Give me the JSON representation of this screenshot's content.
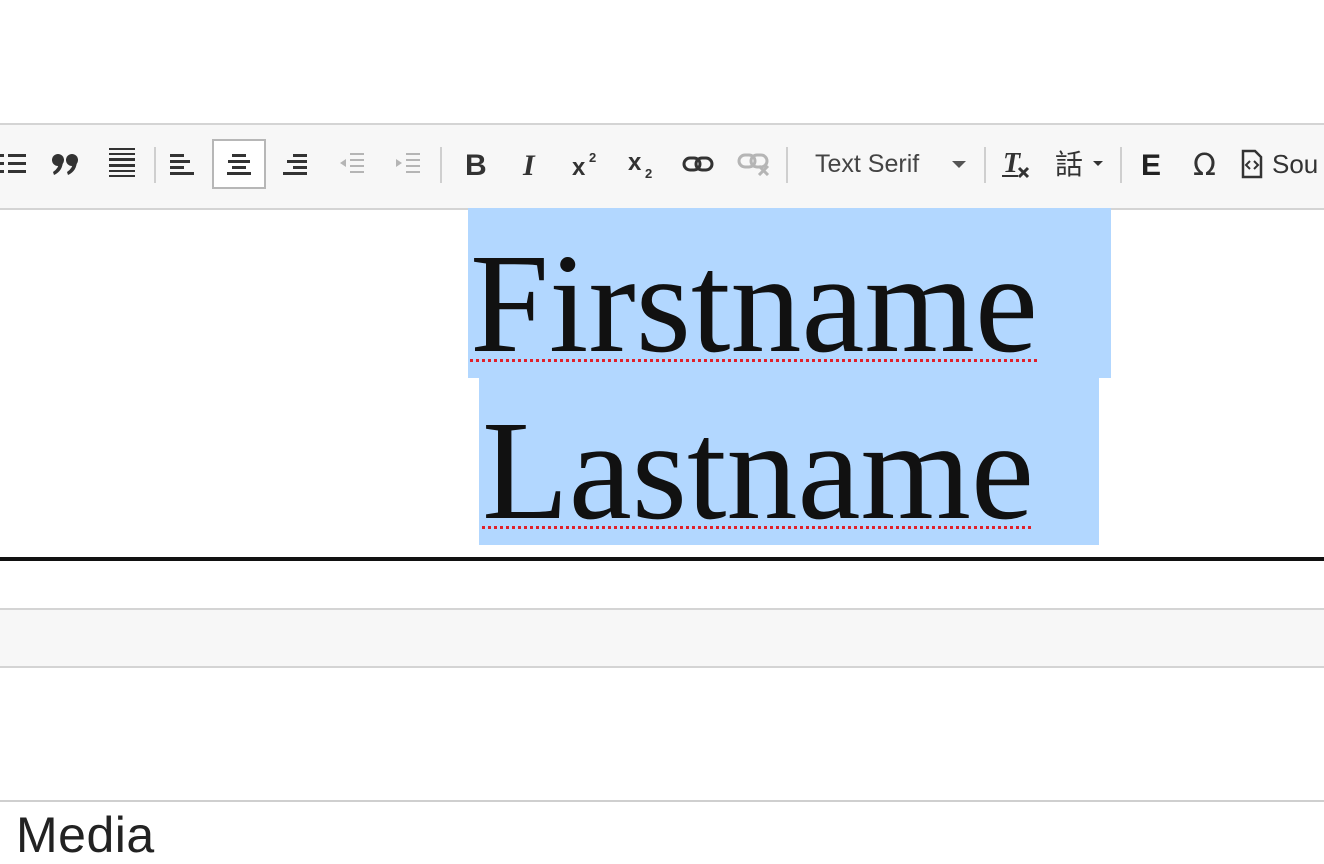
{
  "toolbar": {
    "font_combo": {
      "label": "Text Serif"
    },
    "source_label": "Sou",
    "buttons": [
      {
        "name": "bulleted-list"
      },
      {
        "name": "block-quote"
      },
      {
        "name": "justify"
      },
      {
        "name": "align-left"
      },
      {
        "name": "align-center",
        "active": true
      },
      {
        "name": "align-right"
      },
      {
        "name": "decrease-indent",
        "disabled": true
      },
      {
        "name": "increase-indent",
        "disabled": true
      },
      {
        "name": "bold"
      },
      {
        "name": "italic"
      },
      {
        "name": "superscript"
      },
      {
        "name": "subscript"
      },
      {
        "name": "link"
      },
      {
        "name": "unlink",
        "disabled": true
      },
      {
        "name": "remove-format"
      },
      {
        "name": "language"
      },
      {
        "name": "emphasis"
      },
      {
        "name": "special-character"
      },
      {
        "name": "source"
      }
    ]
  },
  "editor": {
    "line1": "Firstname",
    "line2": "Lastname"
  },
  "media": {
    "title": "Media"
  },
  "colors": {
    "selection": "#b2d7ff",
    "spellcheck_underline": "#e0202a",
    "toolbar_bg": "#f7f7f7"
  }
}
